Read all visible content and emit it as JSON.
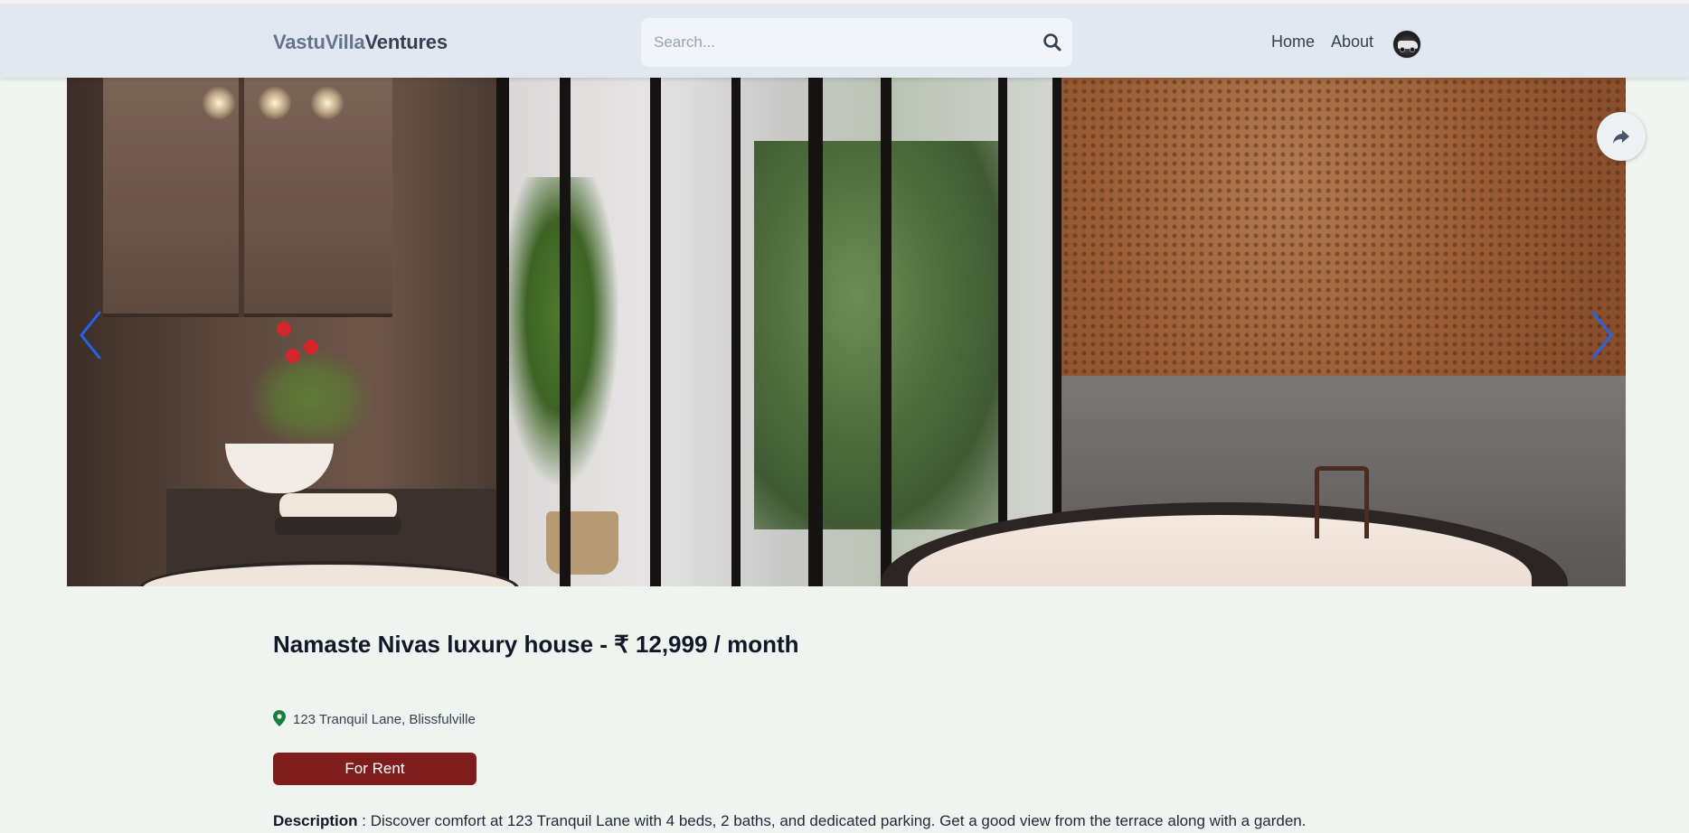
{
  "header": {
    "logo_part1": "VastuVilla",
    "logo_part2": "Ventures",
    "search_placeholder": "Search...",
    "nav": {
      "home": "Home",
      "about": "About"
    }
  },
  "icons": {
    "search": "search-icon",
    "share": "share-icon",
    "prev": "chevron-left-icon",
    "next": "chevron-right-icon",
    "location": "map-pin-icon"
  },
  "colors": {
    "header_bg": "#e2e8f0",
    "page_bg": "#f0f4f1",
    "badge_bg": "#7f1d1d",
    "carousel_arrow": "#2563eb",
    "pin": "#15803d"
  },
  "listing": {
    "title": "Namaste Nivas luxury house - ₹ 12,999 / month",
    "address": "123 Tranquil Lane, Blissfulville",
    "status": "For Rent",
    "description_label": "Description",
    "description_sep": " : ",
    "description": "Discover comfort at 123 Tranquil Lane with 4 beds, 2 baths, and dedicated parking. Get a good view from the terrace along with a garden."
  }
}
